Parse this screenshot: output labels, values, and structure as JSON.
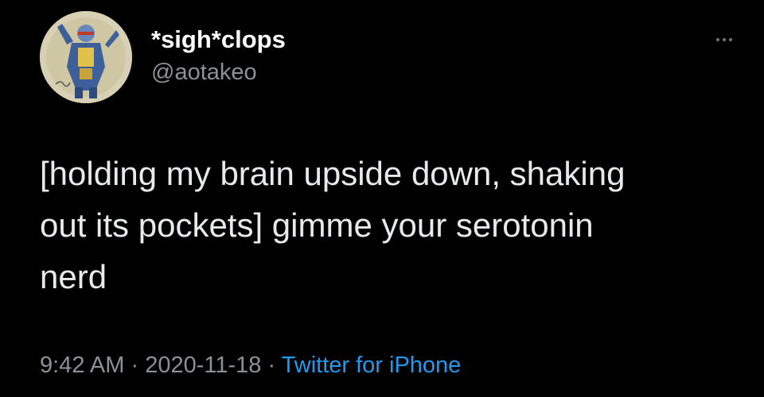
{
  "author": {
    "display_name": "*sigh*clops",
    "handle": "@aotakeo",
    "avatar_icon": "hand-drawn-superhero-avatar"
  },
  "more_icon": "ellipsis-icon",
  "tweet": {
    "lines": [
      "[holding my brain upside down, shaking",
      "out its pockets] gimme your serotonin",
      "nerd"
    ]
  },
  "meta": {
    "time": "9:42 AM",
    "separator": " · ",
    "date": "2020-11-18",
    "source": "Twitter for iPhone"
  },
  "colors": {
    "background": "#000000",
    "name": "#ffffff",
    "text": "#e7e9ea",
    "secondary": "#8b9197",
    "link": "#1d9bf0"
  }
}
